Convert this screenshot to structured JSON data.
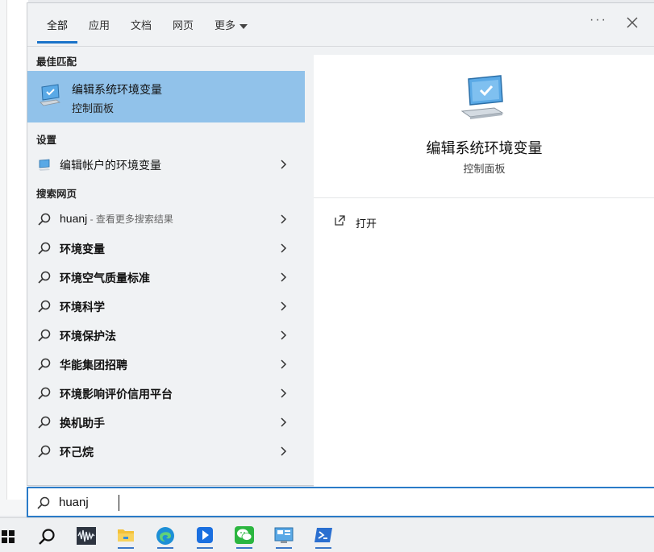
{
  "tabs": [
    {
      "label": "全部",
      "active": true
    },
    {
      "label": "应用",
      "active": false
    },
    {
      "label": "文档",
      "active": false
    },
    {
      "label": "网页",
      "active": false
    },
    {
      "label": "更多",
      "active": false
    }
  ],
  "top_actions": {
    "more_icon": "ellipsis-icon",
    "close_icon": "close-icon"
  },
  "best_match": {
    "section_label": "最佳匹配",
    "title": "编辑系统环境变量",
    "subtitle": "控制面板",
    "icon": "monitor-check-icon"
  },
  "settings": {
    "section_label": "设置",
    "items": [
      {
        "label": "编辑帐户的环境变量",
        "icon": "monitor-settings-icon"
      }
    ]
  },
  "web_search": {
    "section_label": "搜索网页",
    "items": [
      {
        "label": "huanj",
        "hint": " - 查看更多搜索结果",
        "bold": false
      },
      {
        "label": "环境变量",
        "bold": true
      },
      {
        "label": "环境空气质量标准",
        "bold": true
      },
      {
        "label": "环境科学",
        "bold": true
      },
      {
        "label": "环境保护法",
        "bold": true
      },
      {
        "label": "华能集团招聘",
        "bold": true
      },
      {
        "label": "环境影响评价信用平台",
        "bold": true
      },
      {
        "label": "换机助手",
        "bold": true
      },
      {
        "label": "环己烷",
        "bold": true
      }
    ]
  },
  "preview": {
    "title": "编辑系统环境变量",
    "subtitle": "控制面板",
    "actions": [
      {
        "label": "打开",
        "icon": "open-external-icon"
      }
    ]
  },
  "search_box": {
    "value": "huanj",
    "icon": "search-icon"
  },
  "taskbar": {
    "items": [
      {
        "name": "start",
        "icon": "windows-start-icon"
      },
      {
        "name": "search",
        "icon": "search-icon"
      },
      {
        "name": "audio-app",
        "icon": "waveform-icon"
      },
      {
        "name": "file-explorer",
        "icon": "folder-icon"
      },
      {
        "name": "edge",
        "icon": "edge-browser-icon"
      },
      {
        "name": "feishu",
        "icon": "bookmark-app-icon"
      },
      {
        "name": "wechat",
        "icon": "wechat-icon"
      },
      {
        "name": "control-panel",
        "icon": "control-panel-icon"
      },
      {
        "name": "powershell",
        "icon": "powershell-icon"
      }
    ]
  },
  "colors": {
    "accent": "#2a7bc8",
    "selection": "#91c2ea",
    "panel_bg": "#f0f2f4"
  }
}
